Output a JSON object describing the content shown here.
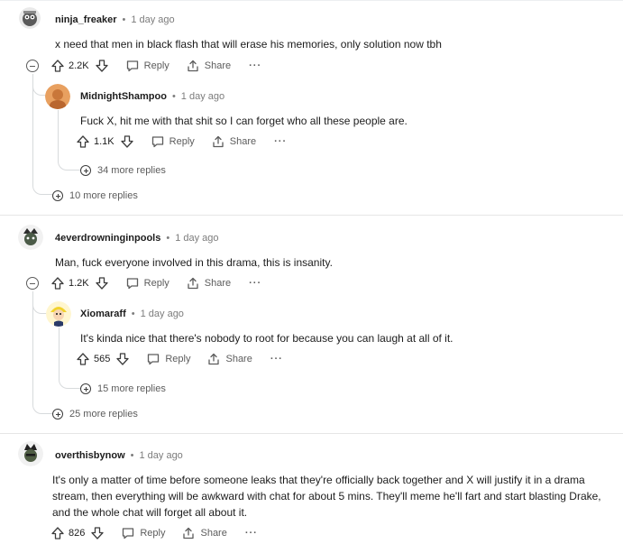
{
  "comments": [
    {
      "user": "ninja_freaker",
      "time": "1 day ago",
      "text": "x need that men in black flash that will erase his memories, only solution now tbh",
      "score": "2.2K",
      "reply_label": "Reply",
      "share_label": "Share",
      "more_label": "···",
      "replies": [
        {
          "user": "MidnightShampoo",
          "time": "1 day ago",
          "text": "Fuck X, hit me with that shit so I can forget who all these people are.",
          "score": "1.1K",
          "reply_label": "Reply",
          "share_label": "Share",
          "more_label": "···",
          "more_replies": "34 more replies"
        }
      ],
      "more_replies": "10 more replies"
    },
    {
      "user": "4everdrowninginpools",
      "time": "1 day ago",
      "text": "Man, fuck everyone involved in this drama, this is insanity.",
      "score": "1.2K",
      "reply_label": "Reply",
      "share_label": "Share",
      "more_label": "···",
      "replies": [
        {
          "user": "Xiomaraff",
          "time": "1 day ago",
          "text": "It's kinda nice that there's nobody to root for because you can laugh at all of it.",
          "score": "565",
          "reply_label": "Reply",
          "share_label": "Share",
          "more_label": "···",
          "more_replies": "15 more replies"
        }
      ],
      "more_replies": "25 more replies"
    },
    {
      "user": "overthisbynow",
      "time": "1 day ago",
      "text": "It's only a matter of time before someone leaks that they're officially back together and X will justify it in a drama stream, then everything will be awkward with chat for about 5 mins. They'll meme he'll fart and start blasting Drake, and the whole chat will forget all about it.",
      "score": "826",
      "reply_label": "Reply",
      "share_label": "Share",
      "more_label": "···"
    }
  ],
  "separator": "•",
  "icons": {
    "upvote": "upvote-arrow-icon",
    "downvote": "downvote-arrow-icon",
    "reply": "reply-bubble-icon",
    "share": "share-icon",
    "collapse": "collapse-minus-icon",
    "expand": "expand-plus-icon"
  },
  "colors": {
    "text": "#1c1c1c",
    "meta": "#7c7c7c",
    "action": "#5c5c5c",
    "thread_line": "#d7dadc",
    "separator": "#e6e6e6"
  }
}
